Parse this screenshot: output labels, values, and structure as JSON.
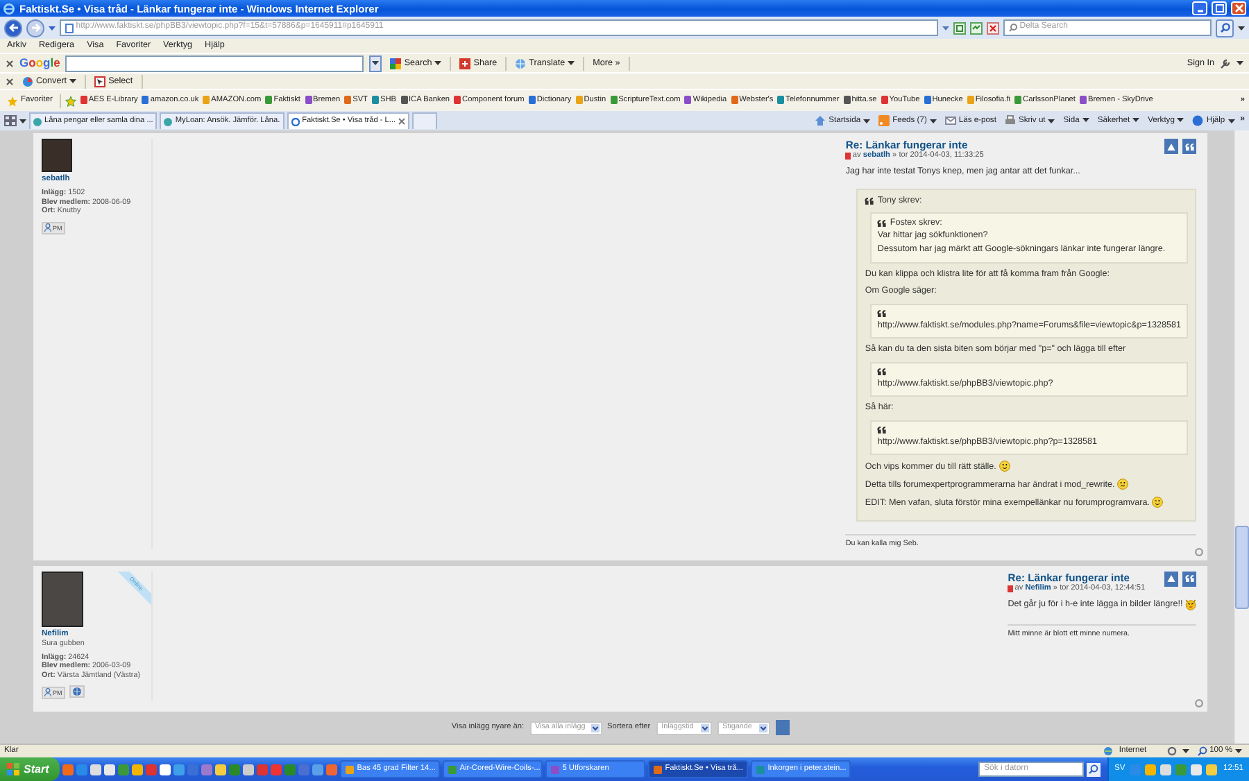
{
  "window": {
    "title": "Faktiskt.Se • Visa tråd - Länkar fungerar inte - Windows Internet Explorer"
  },
  "address_bar": {
    "url": "http://www.faktiskt.se/phpBB3/viewtopic.php?f=15&t=57886&p=1645911#p1645911",
    "search_placeholder": "Delta Search"
  },
  "menu": [
    "Arkiv",
    "Redigera",
    "Visa",
    "Favoriter",
    "Verktyg",
    "Hjälp"
  ],
  "google_toolbar": {
    "logo": "Google",
    "buttons": [
      {
        "label": "Search",
        "dropdown": true
      },
      {
        "label": "Share",
        "dropdown": false
      },
      {
        "label": "Translate",
        "dropdown": true
      },
      {
        "label": "More »",
        "dropdown": false
      }
    ],
    "sign_in": "Sign In"
  },
  "convert_toolbar": {
    "buttons": [
      {
        "label": "Convert",
        "dropdown": true
      },
      {
        "label": "Select",
        "dropdown": false
      }
    ]
  },
  "favorites_bar": {
    "label": "Favoriter",
    "more": "»",
    "links": [
      "AES E-Library",
      "amazon.co.uk",
      "AMAZON.com",
      "Faktiskt",
      "Bremen",
      "SVT",
      "SHB",
      "ICA Banken",
      "Component forum",
      "Dictionary",
      "Dustin",
      "ScriptureText.com",
      "Wikipedia",
      "Webster's",
      "Telefonnummer",
      "hitta.se",
      "YouTube",
      "Hunecke",
      "Filosofia.fi",
      "CarlssonPlanet",
      "Bremen - SkyDrive"
    ]
  },
  "tabs": [
    {
      "label": "Låna pengar eller samla dina ...",
      "selected": false
    },
    {
      "label": "MyLoan: Ansök. Jämför. Låna.",
      "selected": false
    },
    {
      "label": "Faktiskt.Se • Visa tråd - L...",
      "selected": true
    }
  ],
  "command_bar": {
    "more": "»",
    "items": [
      {
        "label": "Startsida",
        "dropdown": true
      },
      {
        "label": "Feeds (7)",
        "dropdown": true
      },
      {
        "label": "Läs e-post",
        "dropdown": false
      },
      {
        "label": "Skriv ut",
        "dropdown": true
      },
      {
        "label": "Sida",
        "dropdown": true
      },
      {
        "label": "Säkerhet",
        "dropdown": true
      },
      {
        "label": "Verktyg",
        "dropdown": true
      },
      {
        "label": "Hjälp",
        "dropdown": true
      }
    ]
  },
  "posts": [
    {
      "author": "sebatlh",
      "online": false,
      "profile_fields": [
        "**Inlägg:** 1502",
        "**Blev medlem:** 2008-06-09",
        "**Ort:** Knutby"
      ],
      "profile_buttons": [
        {
          "kind": "pm",
          "label": "PM"
        }
      ],
      "title": "Re: Länkar fungerar inte",
      "meta": "av **sebatlh** » tor 2014-04-03, 11:33:25",
      "body": [
        {
          "kind": "text",
          "text": "Jag har inte testat Tonys knep, men jag antar att det funkar..."
        },
        {
          "kind": "quote",
          "author": "Tony skrev:",
          "blocks": [
            {
              "kind": "quote",
              "author": "Fostex skrev:",
              "blocks": [
                {
                  "kind": "text",
                  "text": "Var hittar jag sökfunktionen?"
                },
                {
                  "kind": "text",
                  "text": "Dessutom har jag märkt att Google-sökningars länkar inte fungerar längre."
                }
              ]
            },
            {
              "kind": "text",
              "text": "Du kan klippa och klistra lite för att få komma fram från Google:"
            },
            {
              "kind": "text",
              "text": "Om Google säger:"
            },
            {
              "kind": "quote",
              "blocks": [
                {
                  "kind": "text",
                  "text": "http://www.faktiskt.se/modules.php?name=Forums&file=viewtopic&p=1328581"
                }
              ]
            },
            {
              "kind": "text",
              "text": "Så kan du ta den sista biten som börjar med \"p=\" och lägga till efter"
            },
            {
              "kind": "quote",
              "blocks": [
                {
                  "kind": "text",
                  "text": "http://www.faktiskt.se/phpBB3/viewtopic.php?"
                }
              ]
            },
            {
              "kind": "text",
              "text": "Så här:"
            },
            {
              "kind": "quote",
              "blocks": [
                {
                  "kind": "text",
                  "text": "http://www.faktiskt.se/phpBB3/viewtopic.php?p=1328581"
                }
              ]
            },
            {
              "kind": "smile",
              "text": "Och vips kommer du till rätt ställe."
            },
            {
              "kind": "confused",
              "text": "Detta tills forumexpertprogrammerarna har ändrat i mod_rewrite."
            },
            {
              "kind": "wink",
              "text": "EDIT: Men vafan, sluta förstör mina exempellänkar nu forumprogramvara."
            }
          ]
        }
      ],
      "signature": "Du kan kalla mig Seb."
    },
    {
      "author": "Nefilim",
      "rank": "Sura gubben",
      "online": true,
      "online_label": "Online",
      "profile_fields": [
        "**Inlägg:** 24624",
        "**Blev medlem:** 2006-03-09",
        "**Ort:** Värsta Jämtland (Västra)"
      ],
      "profile_buttons": [
        {
          "kind": "pm",
          "label": "PM"
        },
        {
          "kind": "www"
        }
      ],
      "title": "Re: Länkar fungerar inte",
      "meta": "av **Nefilim** » tor 2014-04-03, 12:44:51",
      "body": [
        {
          "kind": "evil",
          "text": "Det går ju för i h-e inte lägga in bilder längre!!"
        }
      ],
      "signature": "Mitt minne är blott ett minne numera."
    }
  ],
  "sort_bar": {
    "filter_label": "Visa inlägg nyare än:",
    "filter_value": "Visa alla inlägg",
    "sort_label": "Sortera efter",
    "sort_value": "Inläggstid",
    "order_value": "Stigande"
  },
  "status_bar": {
    "text": "Klar",
    "zone": "Internet",
    "zoom": "100 %"
  },
  "taskbar": {
    "start": "Start",
    "tasks": [
      {
        "label": "Bas 45 grad Filter 14...",
        "selected": false
      },
      {
        "label": "Air-Cored-Wire-Coils-...",
        "selected": false
      },
      {
        "label": "5 Utforskaren",
        "selected": false
      },
      {
        "label": "Faktiskt.Se • Visa trå...",
        "selected": true
      },
      {
        "label": "Inkorgen i peter.stein...",
        "selected": false
      }
    ],
    "search_placeholder": "Sök i datorn",
    "language": "SV",
    "clock": "12:51"
  }
}
